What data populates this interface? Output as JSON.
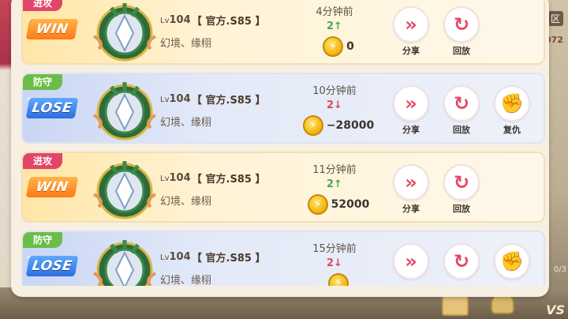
{
  "background": {
    "right_label": "区",
    "right_number": "072",
    "right_number2": "0/3",
    "vs_label": "VS"
  },
  "records": [
    {
      "tag": "进攻",
      "result": "WIN",
      "level_prefix": "Lv",
      "level": "104",
      "server": "【 官方.S85 】",
      "names": "幻境、缘栩",
      "time": "4分钟前",
      "rank": "2↑",
      "coins": "0",
      "actions": [
        "分享",
        "回放"
      ]
    },
    {
      "tag": "防守",
      "result": "LOSE",
      "level_prefix": "Lv",
      "level": "104",
      "server": "【 官方.S85 】",
      "names": "幻境、缘栩",
      "time": "10分钟前",
      "rank": "2↓",
      "coins": "−28000",
      "actions": [
        "分享",
        "回放",
        "复仇"
      ]
    },
    {
      "tag": "进攻",
      "result": "WIN",
      "level_prefix": "Lv",
      "level": "104",
      "server": "【 官方.S85 】",
      "names": "幻境、缘栩",
      "time": "11分钟前",
      "rank": "2↑",
      "coins": "52000",
      "actions": [
        "分享",
        "回放"
      ]
    },
    {
      "tag": "防守",
      "result": "LOSE",
      "level_prefix": "Lv",
      "level": "104",
      "server": "【 官方.S85 】",
      "names": "幻境、缘栩",
      "time": "15分钟前",
      "rank": "2↓",
      "coins": "",
      "actions": [
        "",
        "",
        ""
      ]
    }
  ],
  "icons": {
    "share": "share-icon",
    "replay": "replay-icon",
    "revenge": "revenge-icon",
    "coin": "coin-icon"
  },
  "colors": {
    "win_tag": "#e2456a",
    "lose_tag": "#6cbd47",
    "rank_up": "#4ca84a",
    "rank_down": "#e0475a",
    "action_accent": "#e84666"
  }
}
